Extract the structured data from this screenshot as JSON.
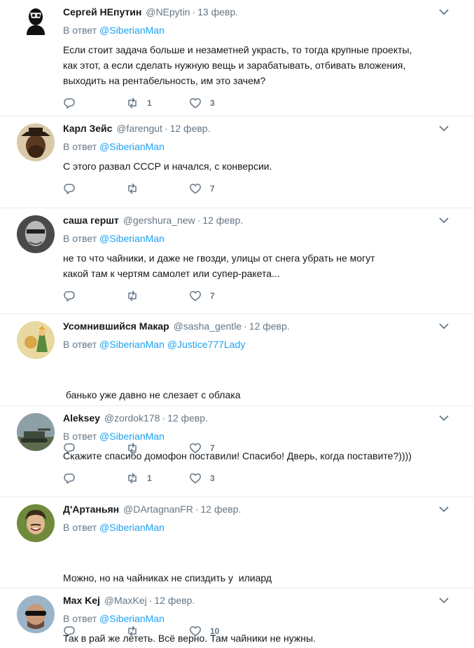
{
  "reply_prefix": "В ответ",
  "colors": {
    "link": "#1da1f2",
    "meta": "#657786",
    "text": "#14171a",
    "divider": "#e6ecf0"
  },
  "tweets": [
    {
      "name": "Сергей НЕпутин",
      "handle": "@NEpytin",
      "date": "13 февр.",
      "reply_to": [
        "@SiberianMan"
      ],
      "text_lines": [
        "Если стоит задача больше и незаметней украсть, то тогда крупные проекты,",
        "как этот, а если сделать нужную вещь и зарабатывать, отбивать вложения,",
        "выходить на рентабельность, им это зачем?"
      ],
      "retweets": "1",
      "likes": "3"
    },
    {
      "name": "Карл Зейс",
      "handle": "@farengut",
      "date": "12 февр.",
      "reply_to": [
        "@SiberianMan"
      ],
      "text_lines": [
        "С этого развал СССР и начался, с конверсии."
      ],
      "retweets": "",
      "likes": "7"
    },
    {
      "name": "саша гершт",
      "handle": "@gershura_new",
      "date": "12 февр.",
      "reply_to": [
        "@SiberianMan"
      ],
      "text_lines": [
        "не то что чайники, и даже не гвозди, улицы от снега убрать не могут",
        "какой там к чертям самолет или супер-ракета..."
      ],
      "retweets": "",
      "likes": "7"
    },
    {
      "name": "Усомнившийся Макар",
      "handle": "@sasha_gentle",
      "date": "12 февр.",
      "reply_to": [
        "@SiberianMan",
        "@Justice777Lady"
      ],
      "text_lines": [
        " банько уже давно не слезает с облака"
      ],
      "retweets": "",
      "likes": "7"
    },
    {
      "name": "Aleksey",
      "handle": "@zordok178",
      "date": "12 февр.",
      "reply_to": [
        "@SiberianMan"
      ],
      "text_lines": [
        "Скажите спасибо домофон поставили! Спасибо! Дверь, когда поставите?))))"
      ],
      "retweets": "1",
      "likes": "3"
    },
    {
      "name": "Д'Артаньян",
      "handle": "@DArtagnanFR",
      "date": "12 февр.",
      "reply_to": [
        "@SiberianMan"
      ],
      "text_lines": [
        "Можно, но на чайниках не спиздить у  илиард"
      ],
      "retweets": "",
      "likes": "10"
    },
    {
      "name": "Max Kej",
      "handle": "@MaxKej",
      "date": "12 февр.",
      "reply_to": [
        "@SiberianMan"
      ],
      "text_lines": [
        "Так в рай же лететь. Всё верно. Там чайники не нужны."
      ],
      "retweets": "",
      "likes": ""
    }
  ]
}
